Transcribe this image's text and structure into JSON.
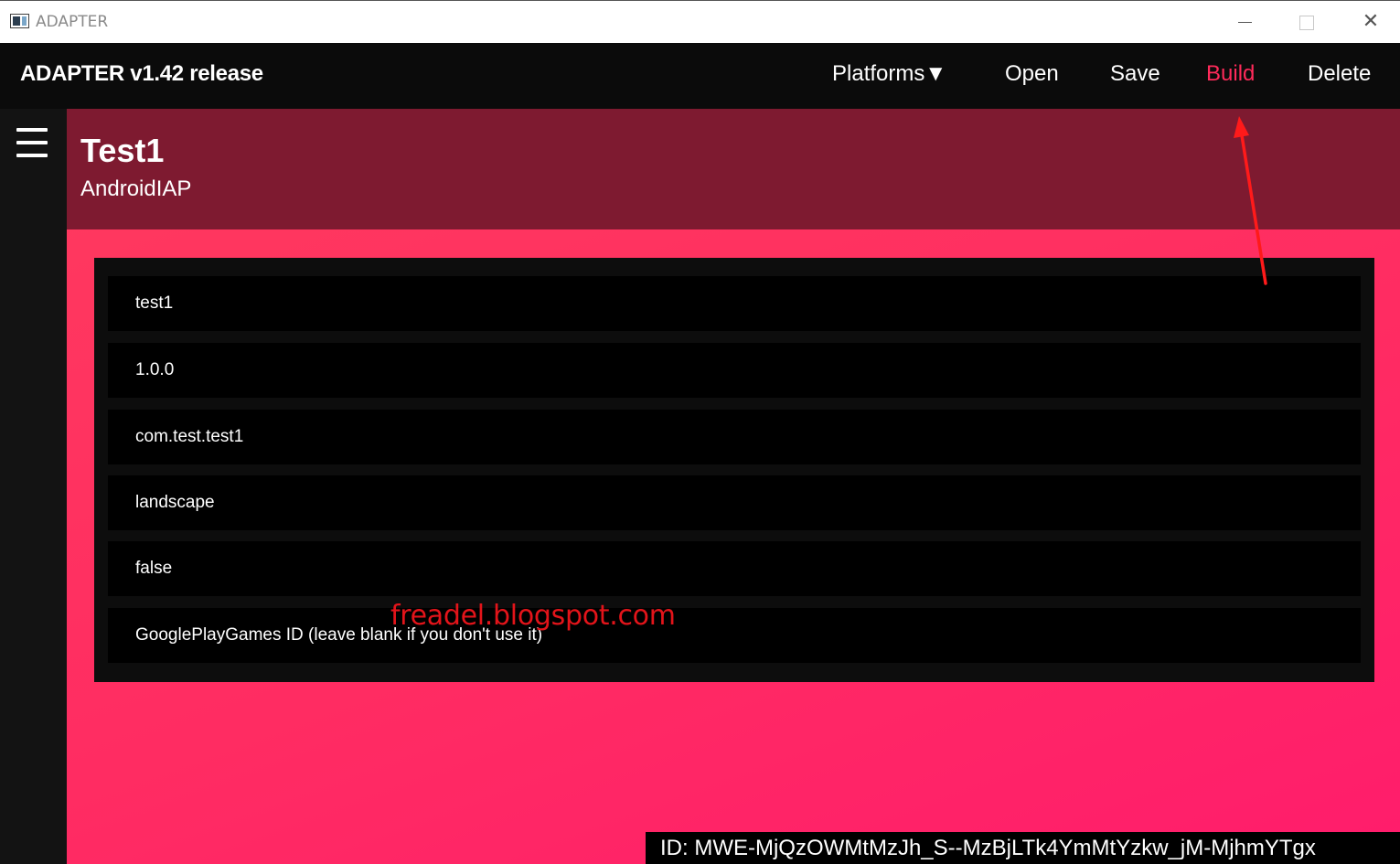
{
  "window": {
    "title": "ADAPTER",
    "icons": [
      "app-icon",
      "minimize-icon",
      "maximize-icon",
      "close-icon"
    ],
    "close_glyph": "✕"
  },
  "appbar": {
    "title": "ADAPTER v1.42 release",
    "nav": {
      "platforms": "Platforms▼",
      "open": "Open",
      "save": "Save",
      "build": "Build",
      "delete": "Delete"
    },
    "accent_color": "#ff2a5a"
  },
  "sidebar": {
    "menu_icon": "hamburger-menu-icon"
  },
  "project": {
    "name": "Test1",
    "subtitle": "AndroidIAP"
  },
  "form": {
    "fields": [
      {
        "placeholder": "test1"
      },
      {
        "placeholder": "1.0.0"
      },
      {
        "placeholder": "com.test.test1"
      },
      {
        "placeholder": "landscape"
      },
      {
        "placeholder": "false"
      },
      {
        "placeholder": "GooglePlayGames ID (leave blank if you don't use it)"
      }
    ]
  },
  "watermark": "freadel.blogspot.com",
  "footer": {
    "id_text": "ID: MWE-MjQzOWMtMzJh_S--MzBjLTk4YmMtYzkw_jM-MjhmYTgx"
  },
  "annotation": {
    "arrow_color": "#ff1a1a",
    "points_to": "Build"
  },
  "colors": {
    "appbar_bg": "#0b0b0b",
    "header_bg": "#7e1a30",
    "content_bg": "#ff2c62",
    "card_bg": "#0d0d0d"
  }
}
